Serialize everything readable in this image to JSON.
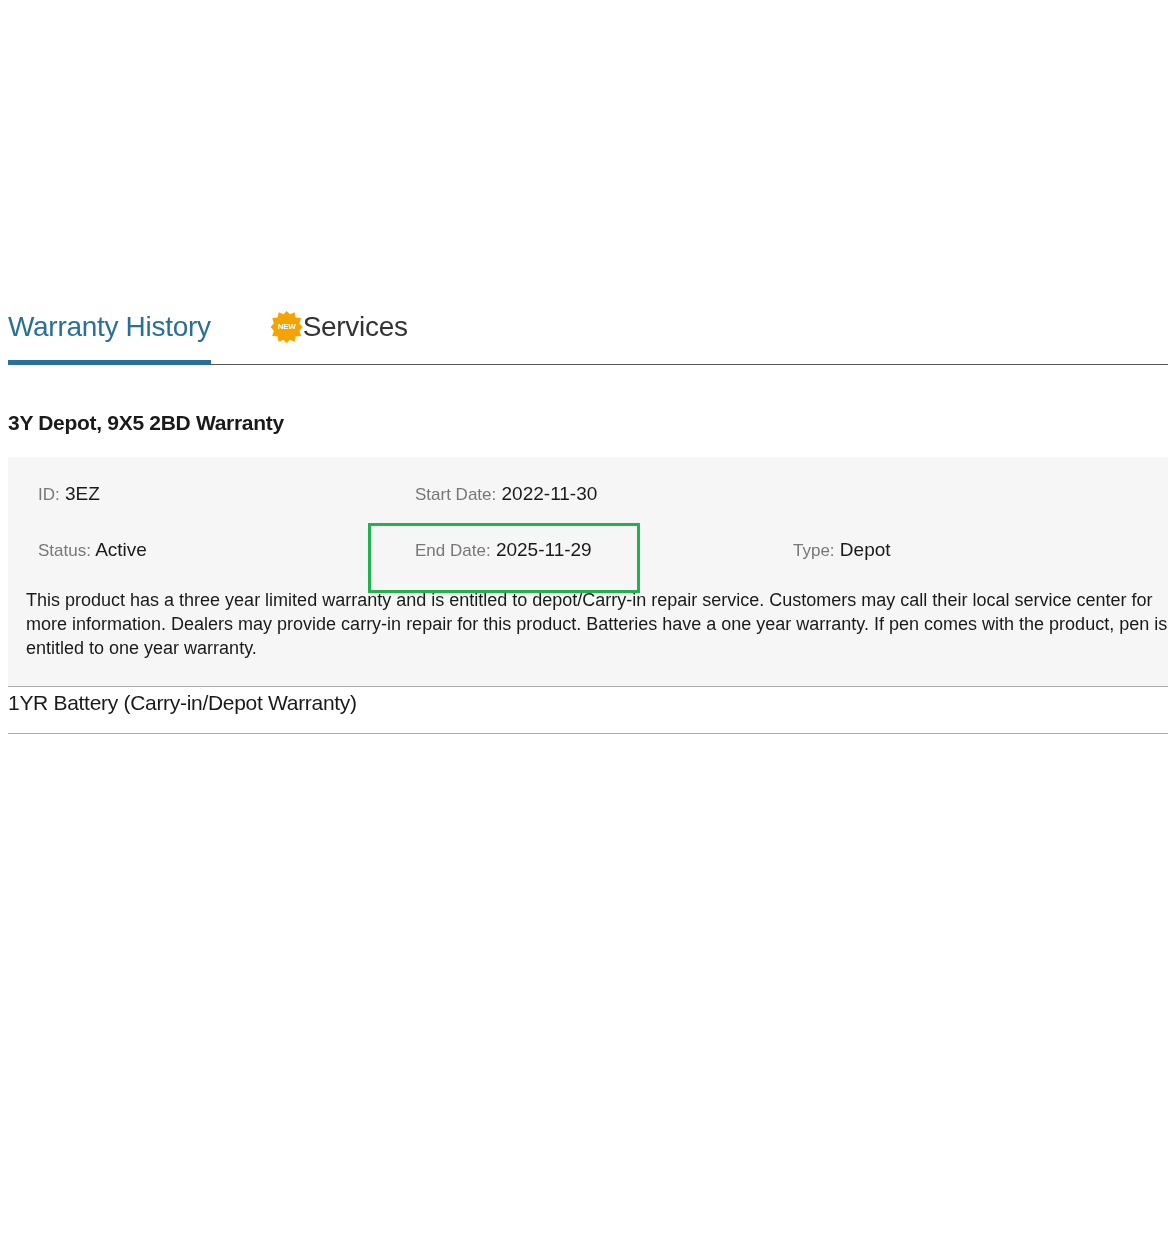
{
  "tabs": [
    {
      "label": "Warranty History",
      "selected": true
    },
    {
      "label": "Services",
      "selected": false,
      "badge": "NEW"
    }
  ],
  "warranties": [
    {
      "title": "3Y Depot, 9X5 2BD Warranty",
      "expanded": true,
      "field_rows": [
        [
          {
            "label": "ID:",
            "value": "3EZ",
            "highlighted": false
          },
          {
            "label": "Start Date:",
            "value": "2022-11-30",
            "highlighted": false
          }
        ],
        [
          {
            "label": "Status:",
            "value": "Active",
            "highlighted": false
          },
          {
            "label": "End Date:",
            "value": "2025-11-29",
            "highlighted": true
          },
          {
            "label": "Type:",
            "value": "Depot",
            "highlighted": false
          }
        ]
      ],
      "description": "This product has a three year limited warranty and is entitled to depot/Carry-in repair service. Customers may call their local service center for more information. Dealers may provide carry-in repair for this product. Batteries have a one year warranty. If pen comes with the product, pen is entitled to one year warranty."
    },
    {
      "title": "1YR Battery (Carry-in/Depot Warranty)",
      "expanded": false
    }
  ]
}
